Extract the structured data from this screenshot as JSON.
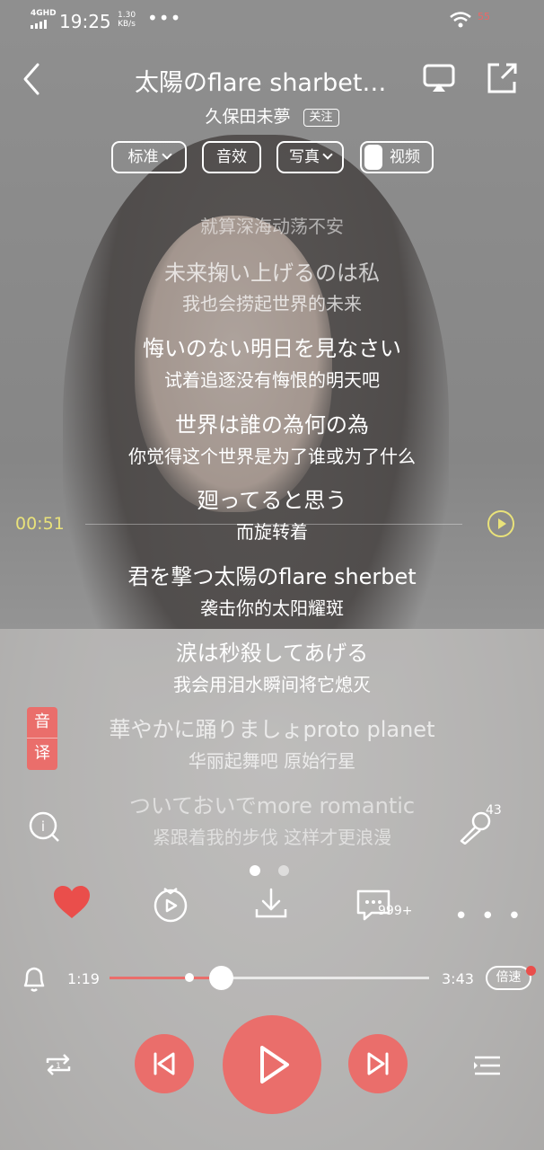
{
  "status_bar": {
    "network": "4GHD",
    "time": "19:25",
    "speed_value": "1.30",
    "speed_unit": "KB/s",
    "more": "•••",
    "battery": "55"
  },
  "header": {
    "title": "太陽のflare sharbet…",
    "artist": "久保田未夢",
    "follow_label": "关注"
  },
  "mode_buttons": {
    "standard": "标准",
    "sound_effect": "音效",
    "photo": "写真",
    "video": "视频"
  },
  "lyrics": [
    {
      "text": "就算深海动荡不安"
    },
    {
      "text": "未来掬い上げるのは私"
    },
    {
      "text": "我也会捞起世界的未来"
    },
    {
      "text": "悔いのない明日を見なさい"
    },
    {
      "text": "试着追逐没有悔恨的明天吧"
    },
    {
      "text": "世界は誰の為何の為"
    },
    {
      "text": "你觉得这个世界是为了谁或为了什么"
    },
    {
      "text": "廻ってると思う"
    },
    {
      "text": "而旋转着"
    },
    {
      "text": "君を撃つ太陽のflare sherbet"
    },
    {
      "text": "袭击你的太阳耀斑"
    },
    {
      "text": "涙は秒殺してあげる"
    },
    {
      "text": "我会用泪水瞬间将它熄灭"
    },
    {
      "text": "華やかに踊りましょproto planet"
    },
    {
      "text": "华丽起舞吧 原始行星"
    },
    {
      "text": "ついておいでmore romantic"
    },
    {
      "text": "紧跟着我的步伐 这样才更浪漫"
    }
  ],
  "current_line_time": "00:51",
  "yin_yi": {
    "top": "音",
    "bottom": "译"
  },
  "mic_count": "43",
  "comment_count": "999+",
  "player": {
    "current_time": "1:19",
    "total_time": "3:43",
    "progress": 0.35,
    "speed_label": "倍速"
  },
  "colors": {
    "accent": "#ea6e6b",
    "highlight": "#e9e27a"
  }
}
